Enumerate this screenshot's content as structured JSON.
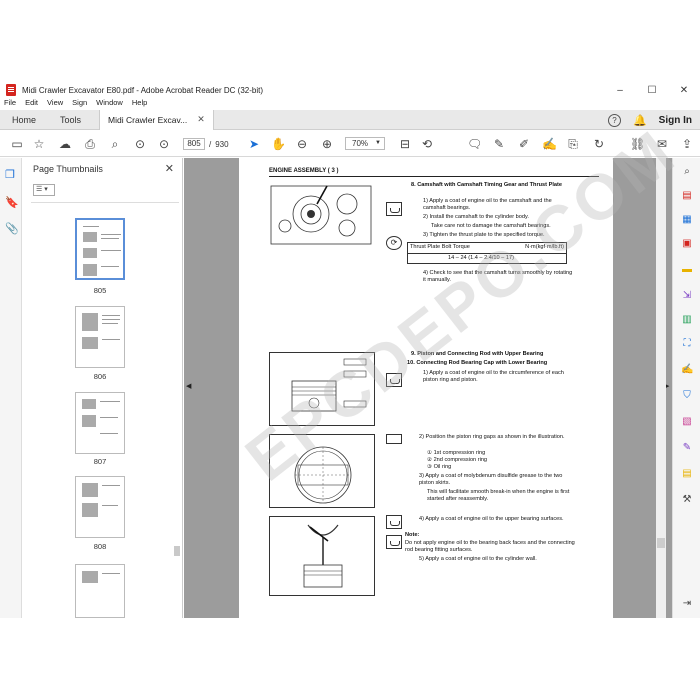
{
  "window": {
    "title": "Midi Crawler Excavator E80.pdf - Adobe Acrobat Reader DC (32-bit)",
    "controls": {
      "minimize": "–",
      "maximize": "☐",
      "close": "✕"
    }
  },
  "menu": [
    "File",
    "Edit",
    "View",
    "Sign",
    "Window",
    "Help"
  ],
  "tabs": {
    "home": "Home",
    "tools": "Tools",
    "document": "Midi Crawler Excav...",
    "document_close": "✕",
    "help": "?",
    "signin": "Sign In"
  },
  "toolbar": {
    "current_page": "805",
    "page_sep": "/",
    "page_count": "930",
    "zoom": "70%"
  },
  "thumbnails": {
    "header": "Page Thumbnails",
    "close": "✕",
    "items": [
      {
        "label": "805"
      },
      {
        "label": "806"
      },
      {
        "label": "807"
      },
      {
        "label": "808"
      }
    ]
  },
  "page": {
    "section_header": "ENGINE ASSEMBLY ( 3 )",
    "step8_title": "8.  Camshaft with Camshaft Timing Gear and Thrust Plate",
    "step8_1": "1)  Apply a coat of engine oil to the camshaft and the camshaft bearings.",
    "step8_2": "2)  Install the camshaft to the cylinder body.",
    "step8_2b": "Take care not to damage the camshaft bearings.",
    "step8_3": "3)  Tighten the thrust plate to the specified torque.",
    "torque_label": "Thrust Plate Bolt Torque",
    "torque_unit": "N·m(kgf·m/lb.ft)",
    "torque_value": "14 – 24 (1.4 – 2.4/10 – 17)",
    "step8_4": "4)  Check to see that the camshaft turns smoothly by rotating it manually.",
    "step9_title": "9.  Piston and Connecting Rod with Upper Bearing",
    "step10_title": "10.  Connecting Rod Bearing Cap with Lower Bearing",
    "step10_1": "1)  Apply a coat of engine oil to the circumference of each piston ring and piston.",
    "step10_2": "2)  Position the piston ring gaps as shown in the illustration.",
    "ring1": "① 1st compression ring",
    "ring2": "② 2nd compression ring",
    "ring3": "③ Oil ring",
    "step10_3": "3)  Apply a coat of molybdenum disulfide grease to the two piston skirts.",
    "step10_3b": "This will facilitate smooth break-in when the engine is first started after reassembly.",
    "step10_4": "4)  Apply a coat of engine oil to the upper bearing surfaces.",
    "note_label": "Note:",
    "note_text": "Do not apply engine oil to the bearing back faces and the connecting rod bearing fitting surfaces.",
    "step10_5": "5)  Apply a coat of engine oil to the cylinder wall."
  },
  "watermark": "EPCDEPO.COM"
}
